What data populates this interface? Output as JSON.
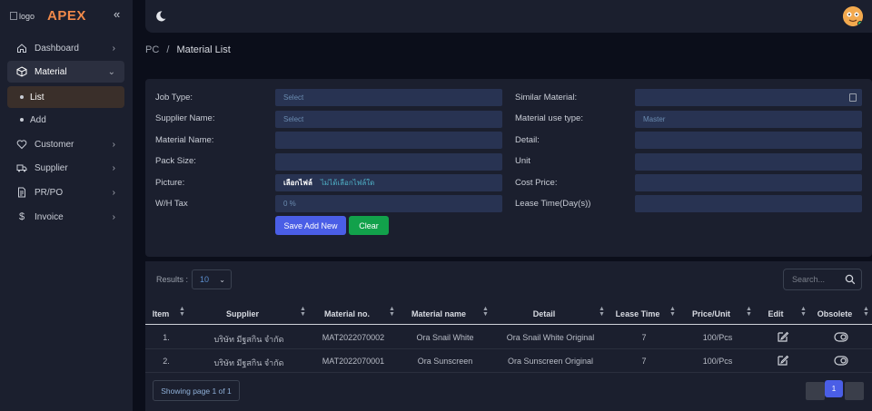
{
  "brand": {
    "logo_alt": "logo",
    "name": "APEX",
    "accent": "#f0894a"
  },
  "sidebar": {
    "items": [
      {
        "label": "Dashboard",
        "icon": "home-icon"
      },
      {
        "label": "Material",
        "icon": "cube-icon"
      },
      {
        "label": "Customer",
        "icon": "heart-icon"
      },
      {
        "label": "Supplier",
        "icon": "truck-icon"
      },
      {
        "label": "PR/PO",
        "icon": "document-icon"
      },
      {
        "label": "Invoice",
        "icon": "dollar-icon"
      }
    ],
    "subitems": [
      {
        "label": "List"
      },
      {
        "label": "Add"
      }
    ]
  },
  "breadcrumb": {
    "root": "PC",
    "sep": "/",
    "current": "Material List"
  },
  "form": {
    "left": [
      {
        "label": "Job Type:",
        "value": "Select"
      },
      {
        "label": "Supplier Name:",
        "value": "Select"
      },
      {
        "label": "Material Name:",
        "value": ""
      },
      {
        "label": "Pack Size:",
        "value": ""
      },
      {
        "label": "Picture:",
        "file_button": "เลือกไฟล์",
        "file_status": "ไม่ได้เลือกไฟล์ใด"
      },
      {
        "label": "W/H Tax",
        "value": "0 %"
      }
    ],
    "right": [
      {
        "label": "Similar Material:",
        "value": ""
      },
      {
        "label": "Material use type:",
        "value": "Master"
      },
      {
        "label": "Detail:",
        "value": ""
      },
      {
        "label": "Unit",
        "value": ""
      },
      {
        "label": "Cost Price:",
        "value": ""
      },
      {
        "label": "Lease Time(Day(s))",
        "value": ""
      }
    ],
    "save_label": "Save Add New",
    "clear_label": "Clear"
  },
  "table": {
    "results_label": "Results :",
    "page_size": "10",
    "search_placeholder": "Search...",
    "columns": [
      "Item",
      "Supplier",
      "Material no.",
      "Material name",
      "Detail",
      "Lease Time",
      "Price/Unit",
      "Edit",
      "Obsolete"
    ],
    "rows": [
      {
        "item": "1.",
        "supplier": "บริษัท มีฐสกิน จำกัด",
        "material_no": "MAT2022070002",
        "material_name": "Ora Snail White",
        "detail": "Ora Snail White Original",
        "lease": "7",
        "price": "100/Pcs"
      },
      {
        "item": "2.",
        "supplier": "บริษัท มีฐสกิน จำกัด",
        "material_no": "MAT2022070001",
        "material_name": "Ora Sunscreen",
        "detail": "Ora Sunscreen Original",
        "lease": "7",
        "price": "100/Pcs"
      }
    ],
    "footer_info": "Showing page 1 of 1",
    "current_page": "1"
  },
  "colors": {
    "primary": "#4a5ee6",
    "success": "#12a14b",
    "input_bg": "#283352",
    "panel": "#1b1f2e"
  }
}
